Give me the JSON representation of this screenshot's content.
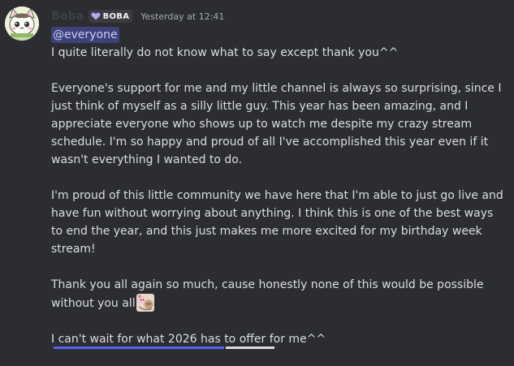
{
  "message": {
    "author": {
      "username": "Boba",
      "clan_tag": "BOBA",
      "clan_icon": "heart-icon",
      "avatar": "cat-avatar"
    },
    "timestamp": "Yesterday at 12:41",
    "mention": "@everyone",
    "paragraphs": [
      {
        "lines": [
          "I quite literally do not know what to say except thank you^^"
        ]
      },
      {
        "lines": [
          "Everyone's support for me and my little channel is always so surprising, since I",
          "just think of myself as a silly little guy. This year has been amazing, and I",
          "appreciate everyone who shows up to watch me despite my crazy stream",
          "schedule. I'm so happy and proud of all I've accomplished this year even if it",
          "wasn't everything I wanted to do."
        ]
      },
      {
        "lines": [
          "I'm proud of this little community we have here that I'm able to just go live and",
          "have fun without worrying about anything. I think this is one of the best ways",
          "to end the year, and this just makes me more excited for my birthday week",
          "stream!"
        ]
      },
      {
        "lines": [
          "Thank you all again so much, cause honestly none of this would be possible",
          "without you all"
        ],
        "trailing_emoji": "hug-emoji"
      },
      {
        "lines": [
          "I can't wait for what 2026 has to offer for me^^"
        ]
      }
    ]
  },
  "colors": {
    "background": "#2b2d31",
    "mention_bg": "#3d4278",
    "mention_text": "#c9cdfb",
    "clan_accent": "#b9a6f7"
  }
}
